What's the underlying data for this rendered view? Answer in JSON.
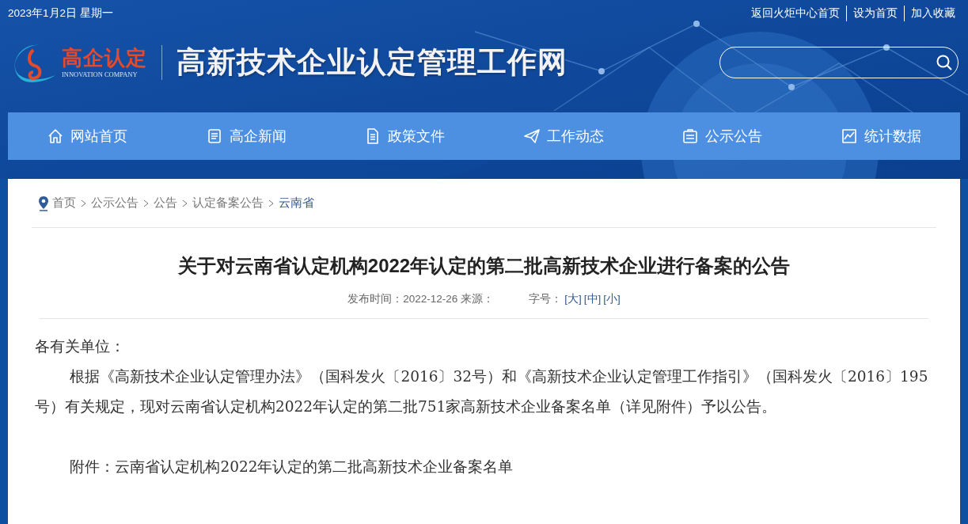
{
  "top_bar": {
    "date": "2023年1月2日 星期一",
    "links": [
      "返回火炬中心首页",
      "设为首页",
      "加入收藏"
    ]
  },
  "header": {
    "logo_text": "高企认定",
    "logo_subtext": "INNOVATION COMPANY",
    "site_title": "高新技术企业认定管理工作网"
  },
  "nav": [
    {
      "label": "网站首页"
    },
    {
      "label": "高企新闻"
    },
    {
      "label": "政策文件"
    },
    {
      "label": "工作动态"
    },
    {
      "label": "公示公告"
    },
    {
      "label": "统计数据"
    }
  ],
  "breadcrumb": [
    {
      "label": "首页",
      "selected": false
    },
    {
      "label": "公示公告",
      "selected": false
    },
    {
      "label": "公告",
      "selected": false
    },
    {
      "label": "认定备案公告",
      "selected": false
    },
    {
      "label": "云南省",
      "selected": true
    }
  ],
  "article": {
    "title": "关于对云南省认定机构2022年认定的第二批高新技术企业进行备案的公告",
    "meta": {
      "date_label": "发布时间：",
      "date": "2022-12-26",
      "source_label": "来源：",
      "size_label": "字号：",
      "sizes": [
        "[大]",
        "[中]",
        "[小]"
      ]
    },
    "paragraphs": [
      {
        "kind": "greeting",
        "text": "各有关单位："
      },
      {
        "kind": "indent",
        "text": "根据《高新技术企业认定管理办法》（国科发火〔2016〕32号）和《高新技术企业认定管理工作指引》（国科发火〔2016〕195号）有关规定，现对云南省认定机构2022年认定的第二批751家高新技术企业备案名单（详见附件）予以公告。"
      },
      {
        "kind": "attachment",
        "text": "附件：云南省认定机构2022年认定的第二批高新技术企业备案名单"
      }
    ]
  }
}
